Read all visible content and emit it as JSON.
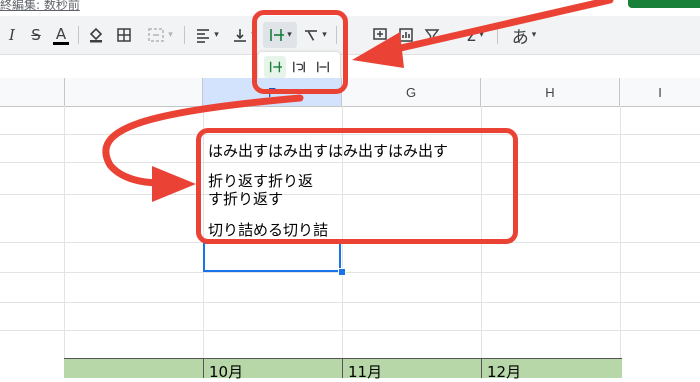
{
  "top": {
    "last_edit": "終編集: 数秒前"
  },
  "toolbar": {
    "italic": "I",
    "strike": "S",
    "text_color": "A",
    "font_lang": "あ",
    "caret": "▾"
  },
  "columns": [
    {
      "label": "F",
      "selected": true
    },
    {
      "label": "G",
      "selected": false
    },
    {
      "label": "H",
      "selected": false
    },
    {
      "label": "I",
      "selected": false
    }
  ],
  "cells": {
    "overflow": "はみ出すはみ出すはみ出すはみ出す",
    "wrap_line1": "折り返す折り返",
    "wrap_line2": "す折り返す",
    "clip": "切り詰める切り詰"
  },
  "months": [
    "10月",
    "11月",
    "12月"
  ],
  "colors": {
    "accent_red": "#ea4335",
    "selection_blue": "#1a73e8",
    "header_green": "#b7d7a8",
    "popup_selected": "#e6f4ea"
  }
}
